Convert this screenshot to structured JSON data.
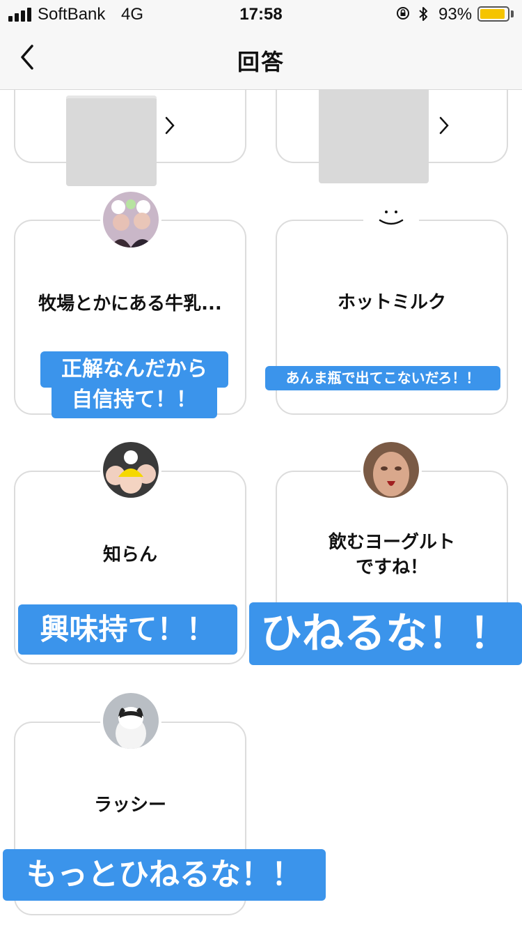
{
  "status_bar": {
    "carrier": "SoftBank",
    "network": "4G",
    "time": "17:58",
    "battery_percent": "93%",
    "battery_level": 0.93,
    "icons": [
      "signal-bars-icon",
      "rotation-lock-icon",
      "bluetooth-icon",
      "battery-icon"
    ]
  },
  "nav": {
    "title": "回答",
    "back_icon": "chevron-left-icon"
  },
  "cards": [
    {
      "answer": "牧場とかにある牛乳...",
      "caption_line1": "正解なんだから",
      "caption_line2": "自信持て！！"
    },
    {
      "answer": "ホットミルク",
      "caption": "あんま瓶で出てこないだろ！！"
    },
    {
      "answer": "知らん",
      "caption": "興味持て！！"
    },
    {
      "answer": "飲むヨーグルト\nですね！",
      "caption": "ひねるな！！"
    },
    {
      "answer": "ラッシー",
      "caption": "もっとひねるな！！"
    }
  ],
  "colors": {
    "caption_bg": "#3b94eb",
    "card_border": "#dcdcdc",
    "battery": "#f5c400"
  }
}
